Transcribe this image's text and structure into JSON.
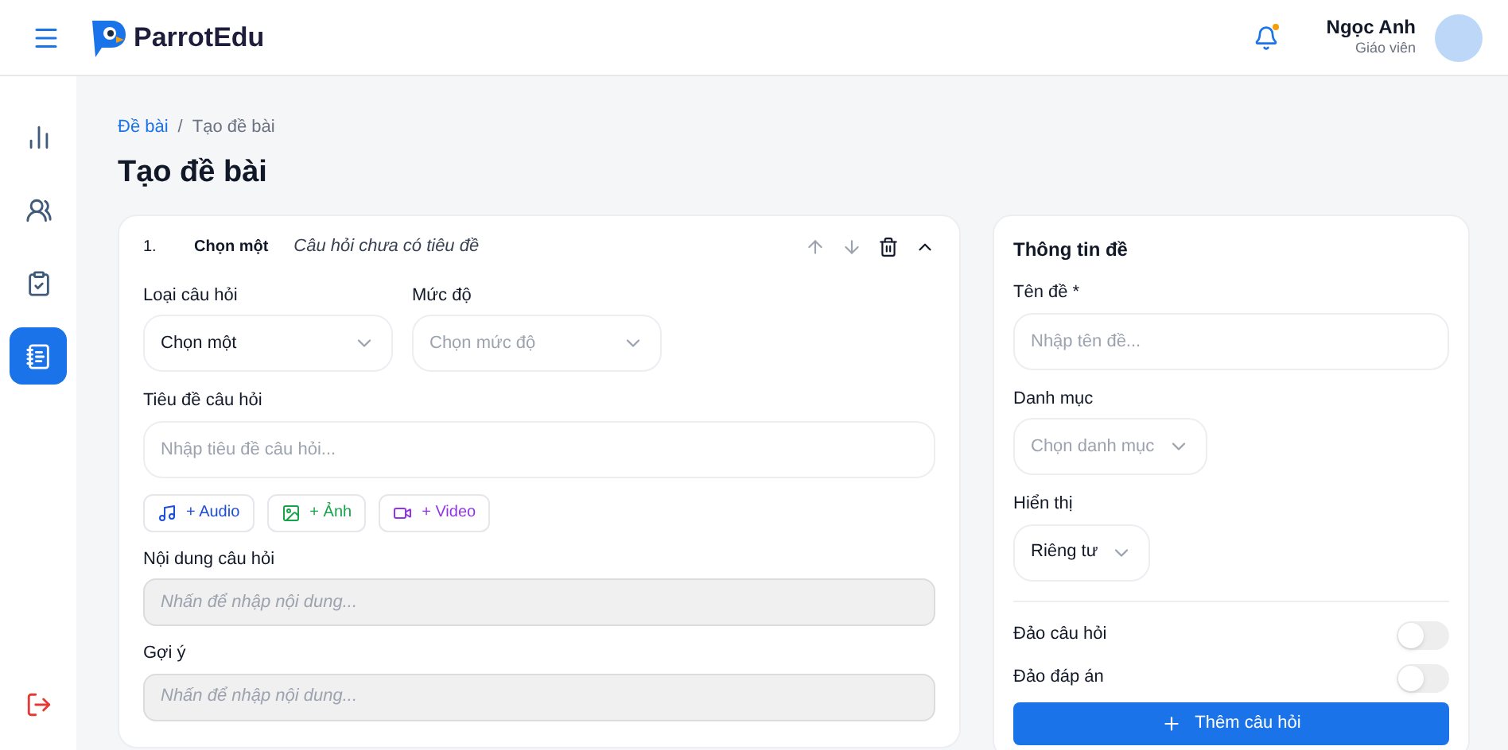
{
  "header": {
    "logo_text": "ParrotEdu",
    "user": {
      "name": "Ngọc Anh",
      "role": "Giáo viên"
    }
  },
  "sidebar": {
    "items": [
      {
        "kind": "chart",
        "selected": false
      },
      {
        "kind": "users",
        "selected": false
      },
      {
        "kind": "tasks",
        "selected": false
      },
      {
        "kind": "notebook",
        "selected": true
      }
    ]
  },
  "breadcrumb": [
    "Đề bài",
    "/",
    "Tạo đề bài"
  ],
  "page_title": "Tạo đề bài",
  "question": {
    "number": "1.",
    "type": "Chọn một",
    "title": "Câu hỏi chưa có tiêu đề",
    "expanded": true,
    "type_field": {
      "label": "Loại câu hỏi",
      "value": "Chọn một"
    },
    "level_field": {
      "label": "Mức độ",
      "placeholder": "Chọn mức độ"
    },
    "title_field": {
      "label": "Tiêu đề câu hỏi",
      "placeholder": "Nhập tiêu đề câu hỏi..."
    },
    "media_buttons": [
      {
        "kind": "audio",
        "label": "+ Audio"
      },
      {
        "kind": "image",
        "label": "+ Ảnh"
      },
      {
        "kind": "video",
        "label": "+ Video"
      }
    ],
    "content_field": {
      "label": "Nội dung câu hỏi",
      "placeholder": "Nhấn để nhập nội dung..."
    },
    "hint_field": {
      "label": "Gợi ý",
      "placeholder": "Nhấn để nhập nội dung..."
    }
  },
  "info_panel": {
    "title": "Thông tin đề",
    "name_field": {
      "label": "Tên đề *",
      "placeholder": "Nhập tên đề..."
    },
    "category_field": {
      "label": "Danh mục",
      "placeholder": "Chọn danh mục"
    },
    "visibility_field": {
      "label": "Hiển thị",
      "value": "Riêng tư"
    },
    "toggles": [
      {
        "label": "Đảo câu hỏi",
        "on": false
      },
      {
        "label": "Đảo đáp án",
        "on": false
      }
    ],
    "add_button": "Thêm câu hỏi"
  }
}
